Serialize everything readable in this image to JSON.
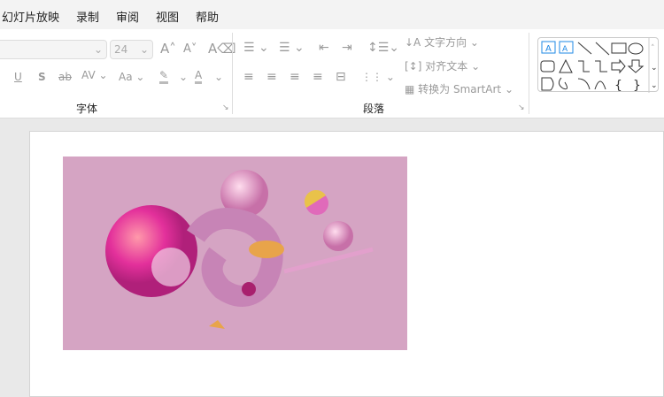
{
  "menu": [
    "幻灯片放映",
    "录制",
    "审阅",
    "视图",
    "帮助"
  ],
  "font": {
    "size": "24",
    "group_label": "字体"
  },
  "paragraph": {
    "text_direction": "文字方向",
    "align_text": "对齐文本",
    "smartart": "转换为 SmartArt",
    "group_label": "段落"
  },
  "colors": {
    "accent": "#1e88e5",
    "image_bg": "#d5a4c3"
  }
}
